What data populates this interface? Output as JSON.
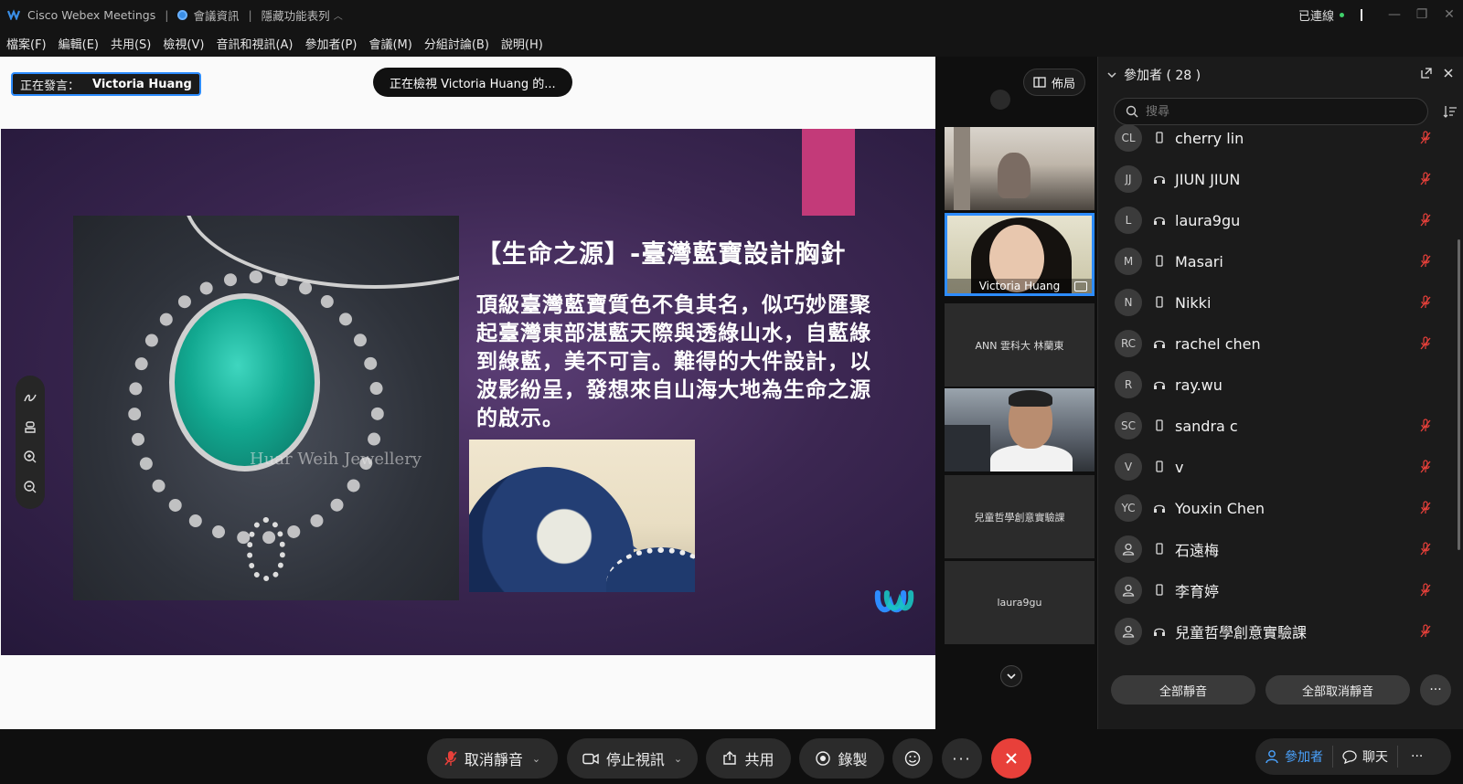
{
  "titlebar": {
    "app_name": "Cisco Webex Meetings",
    "meeting_info": "會議資訊",
    "hide_menu": "隱藏功能表列",
    "status": "已連線",
    "colors": {
      "connected": "#3fcf6a"
    }
  },
  "menubar": {
    "items": [
      "檔案(F)",
      "編輯(E)",
      "共用(S)",
      "檢視(V)",
      "音訊和視訊(A)",
      "參加者(P)",
      "會議(M)",
      "分組討論(B)",
      "說明(H)"
    ]
  },
  "stage": {
    "speaking_label": "正在發言：",
    "speaker_name": "Victoria Huang",
    "viewing_text": "正在檢視 Victoria Huang 的...",
    "slide": {
      "title": "【生命之源】-臺灣藍寶設計胸針",
      "body": "頂級臺灣藍寶質色不負其名，似巧妙匯聚起臺灣東部湛藍天際與透綠山水，自藍綠到綠藍，美不可言。難得的大件設計，以波影紛呈，發想來自山海大地為生命之源的啟示。",
      "watermark": "Huar Weih Jewellery"
    },
    "tools": [
      "annotate-icon",
      "stamp-icon",
      "zoom-in-icon",
      "zoom-out-icon"
    ]
  },
  "video_column": {
    "layout_label": "佈局",
    "tiles": [
      {
        "type": "video",
        "name": ""
      },
      {
        "type": "video",
        "name": "Victoria Huang",
        "active": true
      },
      {
        "type": "name",
        "name": "ANN 雲科大 林蘭東"
      },
      {
        "type": "video",
        "name": ""
      },
      {
        "type": "name",
        "name": "兒童哲學創意實驗課"
      },
      {
        "type": "name",
        "name": "laura9gu"
      }
    ]
  },
  "participants": {
    "header": "參加者 ( 28 )",
    "search_placeholder": "搜尋",
    "list": [
      {
        "initials": "CL",
        "name": "cherry lin",
        "device": "phone",
        "muted": true
      },
      {
        "initials": "JJ",
        "name": "JIUN JIUN",
        "device": "headset",
        "muted": true
      },
      {
        "initials": "L",
        "name": "laura9gu",
        "device": "headset",
        "muted": true
      },
      {
        "initials": "M",
        "name": "Masari",
        "device": "phone",
        "muted": true
      },
      {
        "initials": "N",
        "name": "Nikki",
        "device": "phone",
        "muted": true
      },
      {
        "initials": "RC",
        "name": "rachel chen",
        "device": "headset",
        "muted": true
      },
      {
        "initials": "R",
        "name": "ray.wu",
        "device": "headset",
        "muted": false
      },
      {
        "initials": "SC",
        "name": "sandra c",
        "device": "phone",
        "muted": true
      },
      {
        "initials": "V",
        "name": "v",
        "device": "phone",
        "muted": true
      },
      {
        "initials": "YC",
        "name": "Youxin Chen",
        "device": "headset",
        "muted": true
      },
      {
        "initials": "",
        "name": "石遠梅",
        "device": "phone",
        "muted": true
      },
      {
        "initials": "",
        "name": "李育婷",
        "device": "phone",
        "muted": true
      },
      {
        "initials": "",
        "name": "兒童哲學創意實驗課",
        "device": "headset",
        "muted": true
      }
    ],
    "mute_all": "全部靜音",
    "unmute_all": "全部取消靜音",
    "colors": {
      "muted_icon": "#e8403a"
    }
  },
  "controls": {
    "unmute": "取消靜音",
    "stop_video": "停止視訊",
    "share": "共用",
    "record": "錄製",
    "participants_tab": "參加者",
    "chat_tab": "聊天",
    "colors": {
      "end": "#e8403a",
      "accent": "#2d8cff"
    }
  }
}
